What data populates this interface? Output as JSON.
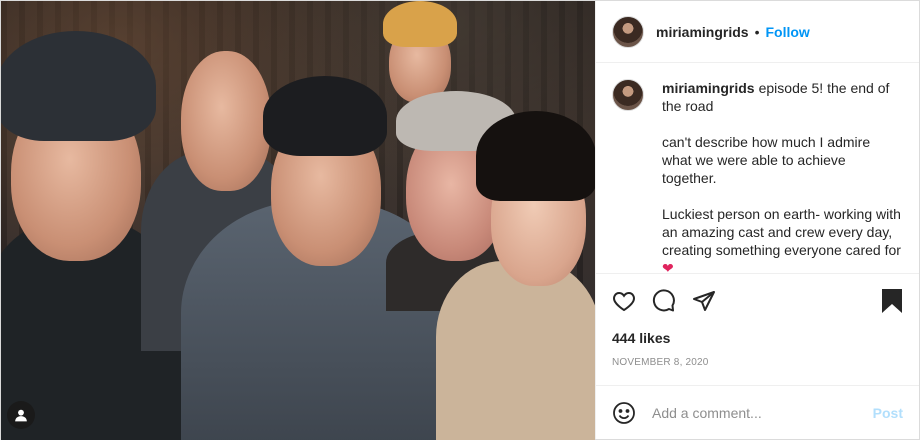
{
  "header": {
    "username": "miriamingrids",
    "separator": "•",
    "follow_label": "Follow"
  },
  "caption": {
    "username": "miriamingrids",
    "lines": [
      "episode 5! the end of the road",
      "can't describe how much I admire what we were able to achieve together.",
      "Luckiest person on earth- working with an amazing cast and crew every day, creating something everyone cared for"
    ],
    "emoji": "❤"
  },
  "actions": {
    "like_icon": "heart-outline-icon",
    "comment_icon": "comment-bubble-icon",
    "share_icon": "paper-plane-icon",
    "save_icon": "bookmark-icon"
  },
  "likes": "444 likes",
  "date": "NOVEMBER 8, 2020",
  "comment_box": {
    "placeholder": "Add a comment...",
    "post_label": "Post"
  },
  "media": {
    "user_tag_icon": "person-tag-icon"
  },
  "colors": {
    "link_blue": "#0095f6",
    "post_disabled": "#b2dffc",
    "muted_text": "#8e8e8e",
    "border": "#efefef"
  }
}
